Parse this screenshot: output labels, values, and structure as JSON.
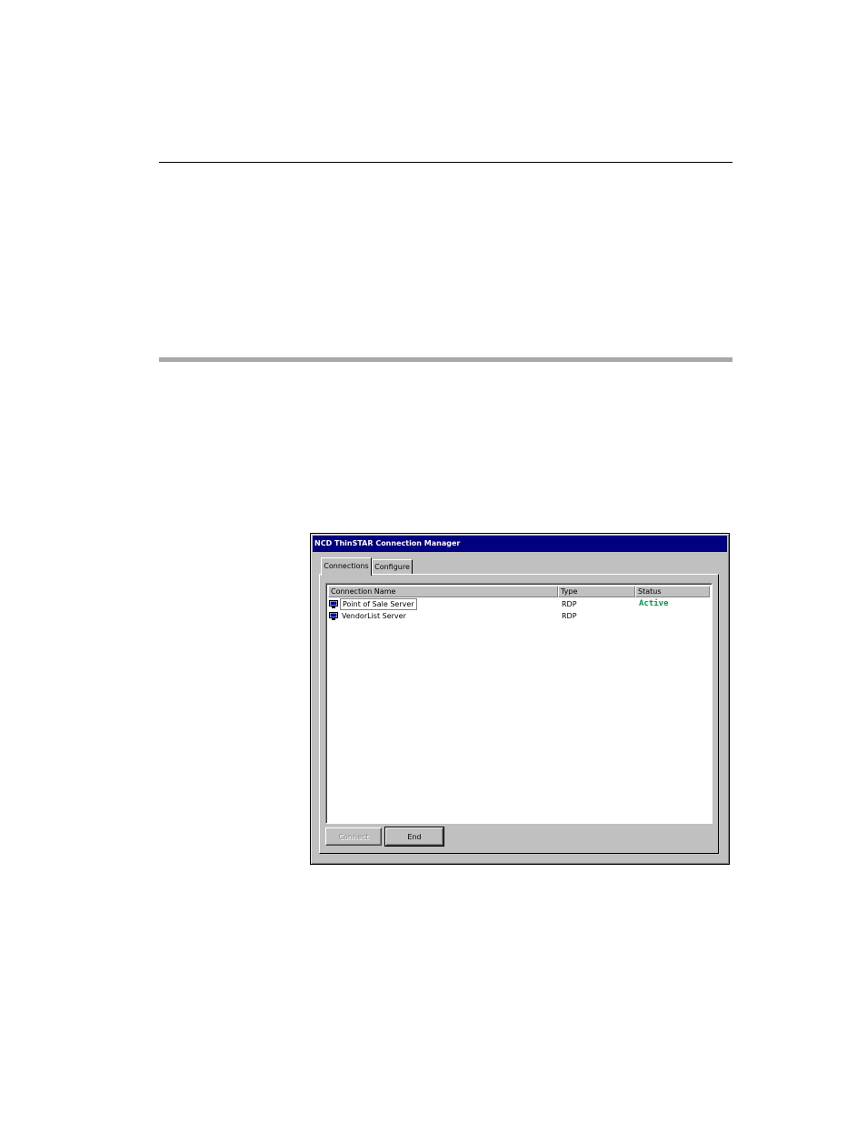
{
  "window": {
    "title": "NCD ThinSTAR Connection Manager"
  },
  "tabs": [
    {
      "label": "Connections",
      "selected": true
    },
    {
      "label": "Configure",
      "selected": false
    }
  ],
  "connections_list": {
    "columns": [
      "Connection Name",
      "Type",
      "Status"
    ],
    "rows": [
      {
        "name": "Point of Sale Server",
        "type": "RDP",
        "status": "Active",
        "focused": true,
        "icon": "connection-icon"
      },
      {
        "name": "VendorList Server",
        "type": "RDP",
        "status": "",
        "focused": false,
        "icon": "connection-icon"
      }
    ]
  },
  "buttons": {
    "connect_label": "Connect",
    "connect_enabled": false,
    "end_label": "End",
    "end_enabled": true
  },
  "colors": {
    "title_bar": "#000080",
    "window_face": "#c0c0c0",
    "status_active": "#009a4e"
  }
}
